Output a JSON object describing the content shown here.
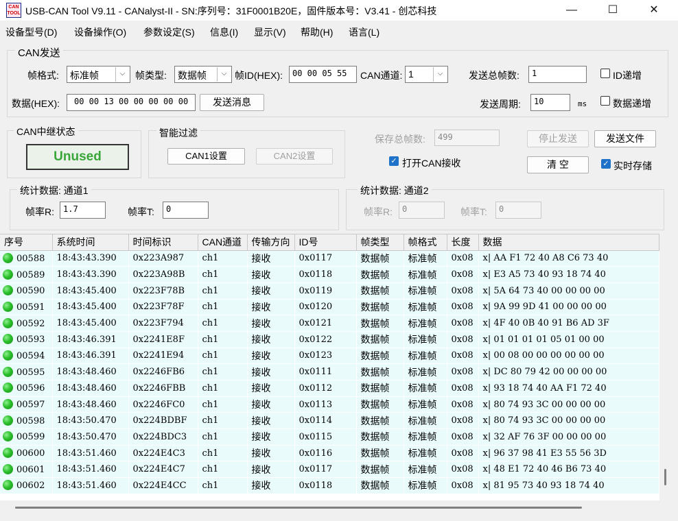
{
  "window": {
    "app_icon": "CAN\nTOOL",
    "title": "USB-CAN Tool V9.11 - CANalyst-II - SN:序列号：31F0001B20E，固件版本号：V3.41 - 创芯科技",
    "minimize_glyph": "—",
    "maximize_glyph": "☐",
    "close_glyph": "✕"
  },
  "menu": [
    "设备型号(D)",
    "设备操作(O)",
    "参数设定(S)",
    "信息(I)",
    "显示(V)",
    "帮助(H)",
    "语言(L)"
  ],
  "can_send": {
    "group_label": "CAN发送",
    "frame_format_label": "帧格式:",
    "frame_format_value": "标准帧",
    "frame_type_label": "帧类型:",
    "frame_type_value": "数据帧",
    "frame_id_label": "帧ID(HEX):",
    "frame_id_value": "00 00 05 55",
    "channel_label": "CAN通道:",
    "channel_value": "1",
    "total_frames_label": "发送总帧数:",
    "total_frames_value": "1",
    "id_increment_label": "ID递增",
    "id_increment_checked": false,
    "data_label": "数据(HEX):",
    "data_value": "00 00 13 00 00 00 00 00",
    "send_button": "发送消息",
    "period_label": "发送周期:",
    "period_value": "10",
    "period_unit": "ms",
    "data_increment_label": "数据递增",
    "data_increment_checked": false,
    "dropdown_icon": "chevron-down-icon"
  },
  "relay_status": {
    "group_label": "CAN中继状态",
    "value": "Unused",
    "value_color": "#3aa63a"
  },
  "smart_filter": {
    "group_label": "智能过滤",
    "can1_button": "CAN1设置",
    "can2_button": "CAN2设置"
  },
  "right_panel": {
    "saved_frames_label": "保存总帧数:",
    "saved_frames_value": "499",
    "open_can_recv_label": "打开CAN接收",
    "open_can_recv_checked": true,
    "stop_send_button": "停止发送",
    "send_file_button": "发送文件",
    "clear_button": "清 空",
    "realtime_save_label": "实时存储",
    "realtime_save_checked": true,
    "check_glyph": "✓"
  },
  "stats1": {
    "group_label": "统计数据: 通道1",
    "rate_r_label": "帧率R:",
    "rate_r_value": "1.7",
    "rate_t_label": "帧率T:",
    "rate_t_value": "0"
  },
  "stats2": {
    "group_label": "统计数据: 通道2",
    "rate_r_label": "帧率R:",
    "rate_r_value": "0",
    "rate_t_label": "帧率T:",
    "rate_t_value": "0"
  },
  "table": {
    "columns": [
      "序号",
      "系统时间",
      "时间标识",
      "CAN通道",
      "传输方向",
      "ID号",
      "帧类型",
      "帧格式",
      "长度",
      "数据"
    ],
    "rows": [
      [
        "00588",
        "18:43:43.390",
        "0x223A987",
        "ch1",
        "接收",
        "0x0117",
        "数据帧",
        "标准帧",
        "0x08",
        "x| AA F1 72 40 A8 C6 73 40"
      ],
      [
        "00589",
        "18:43:43.390",
        "0x223A98B",
        "ch1",
        "接收",
        "0x0118",
        "数据帧",
        "标准帧",
        "0x08",
        "x| E3 A5 73 40 93 18 74 40"
      ],
      [
        "00590",
        "18:43:45.400",
        "0x223F78B",
        "ch1",
        "接收",
        "0x0119",
        "数据帧",
        "标准帧",
        "0x08",
        "x| 5A 64 73 40 00 00 00 00"
      ],
      [
        "00591",
        "18:43:45.400",
        "0x223F78F",
        "ch1",
        "接收",
        "0x0120",
        "数据帧",
        "标准帧",
        "0x08",
        "x| 9A 99 9D 41 00 00 00 00"
      ],
      [
        "00592",
        "18:43:45.400",
        "0x223F794",
        "ch1",
        "接收",
        "0x0121",
        "数据帧",
        "标准帧",
        "0x08",
        "x| 4F 40 0B 40 91 B6 AD 3F"
      ],
      [
        "00593",
        "18:43:46.391",
        "0x2241E8F",
        "ch1",
        "接收",
        "0x0122",
        "数据帧",
        "标准帧",
        "0x08",
        "x| 01 01 01 01 05 01 00 00"
      ],
      [
        "00594",
        "18:43:46.391",
        "0x2241E94",
        "ch1",
        "接收",
        "0x0123",
        "数据帧",
        "标准帧",
        "0x08",
        "x| 00 08 00 00 00 00 00 00"
      ],
      [
        "00595",
        "18:43:48.460",
        "0x2246FB6",
        "ch1",
        "接收",
        "0x0111",
        "数据帧",
        "标准帧",
        "0x08",
        "x| DC 80 79 42 00 00 00 00"
      ],
      [
        "00596",
        "18:43:48.460",
        "0x2246FBB",
        "ch1",
        "接收",
        "0x0112",
        "数据帧",
        "标准帧",
        "0x08",
        "x| 93 18 74 40 AA F1 72 40"
      ],
      [
        "00597",
        "18:43:48.460",
        "0x2246FC0",
        "ch1",
        "接收",
        "0x0113",
        "数据帧",
        "标准帧",
        "0x08",
        "x| 80 74 93 3C 00 00 00 00"
      ],
      [
        "00598",
        "18:43:50.470",
        "0x224BDBF",
        "ch1",
        "接收",
        "0x0114",
        "数据帧",
        "标准帧",
        "0x08",
        "x| 80 74 93 3C 00 00 00 00"
      ],
      [
        "00599",
        "18:43:50.470",
        "0x224BDC3",
        "ch1",
        "接收",
        "0x0115",
        "数据帧",
        "标准帧",
        "0x08",
        "x| 32 AF 76 3F 00 00 00 00"
      ],
      [
        "00600",
        "18:43:51.460",
        "0x224E4C3",
        "ch1",
        "接收",
        "0x0116",
        "数据帧",
        "标准帧",
        "0x08",
        "x| 96 37 98 41 E3 55 56 3D"
      ],
      [
        "00601",
        "18:43:51.460",
        "0x224E4C7",
        "ch1",
        "接收",
        "0x0117",
        "数据帧",
        "标准帧",
        "0x08",
        "x| 48 E1 72 40 46 B6 73 40"
      ],
      [
        "00602",
        "18:43:51.460",
        "0x224E4CC",
        "ch1",
        "接收",
        "0x0118",
        "数据帧",
        "标准帧",
        "0x08",
        "x| 81 95 73 40 93 18 74 40"
      ]
    ],
    "row_status_icon": "green-dot-icon"
  }
}
